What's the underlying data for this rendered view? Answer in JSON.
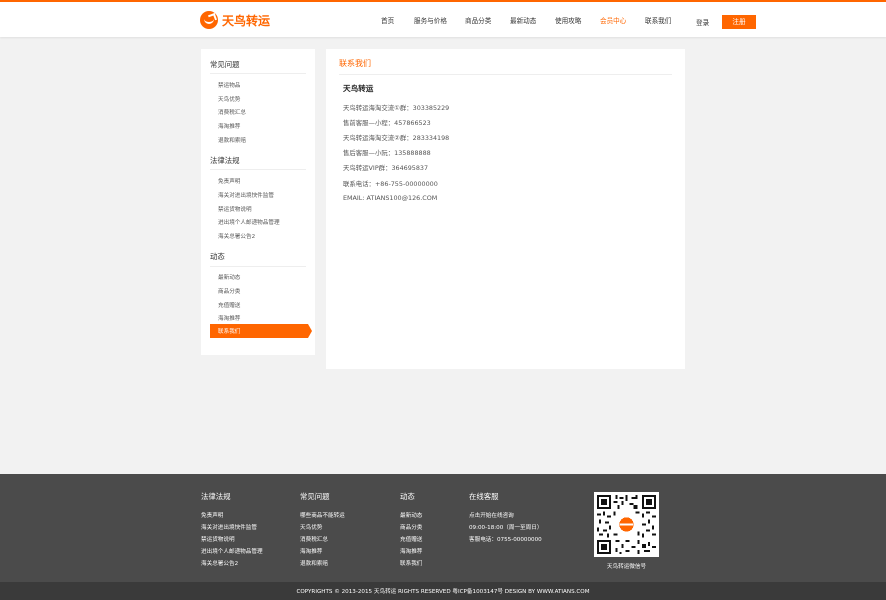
{
  "header": {
    "logo_text": "天鸟转运",
    "nav": [
      "首页",
      "服务与价格",
      "商品分类",
      "最新动态",
      "使用攻略",
      "会员中心",
      "联系我们"
    ],
    "active_nav": "会员中心",
    "login": "登录",
    "register": "注册",
    "accent_color": "#ff6600"
  },
  "sidebar": {
    "groups": [
      {
        "title": "常见问题",
        "items": [
          "禁运物品",
          "天鸟优势",
          "消费税汇总",
          "海淘推荐",
          "退款和索赔"
        ]
      },
      {
        "title": "法律法规",
        "items": [
          "免责声明",
          "海关对进出境快件监管",
          "禁运货物说明",
          "进出境个人邮递物品管理",
          "海关总署公告2"
        ]
      },
      {
        "title": "动态",
        "items": [
          "最新动态",
          "商品分类",
          "充值赠送",
          "海淘推荐",
          "联系我们"
        ]
      }
    ],
    "active_item": "联系我们"
  },
  "main": {
    "title": "联系我们",
    "company": "天鸟转运",
    "lines": [
      "天鸟转运海淘交流①群：303385229",
      "售前客服—小程：457866523",
      "天鸟转运海淘交流②群：283334198",
      "售后客服—小阮：135888888",
      "天鸟转运VIP群：364695837",
      "联系电话：+86-755-00000000",
      "EMAIL: ATIANS100@126.COM"
    ]
  },
  "footer": {
    "columns": [
      {
        "title": "法律法规",
        "items": [
          "免责声明",
          "海关对进出境快件监管",
          "禁运货物说明",
          "进出境个人邮递物品管理",
          "海关总署公告2"
        ]
      },
      {
        "title": "常见问题",
        "items": [
          "哪些商品不能转运",
          "天鸟优势",
          "消费税汇总",
          "海淘推荐",
          "退款和索赔"
        ]
      },
      {
        "title": "动态",
        "items": [
          "最新动态",
          "商品分类",
          "充值赠送",
          "海淘推荐",
          "联系我们"
        ]
      },
      {
        "title": "在线客服",
        "items": [
          "点击开始在线咨询",
          "09:00-18:00（周一至周日）",
          "客服电话：0755-00000000"
        ]
      }
    ],
    "qr_caption": "天鸟转运微信号",
    "copyright": "COPYRIGHTS © 2013-2015 天鸟转运 RIGHTS RESERVED      粤ICP备1003147号      DESIGN BY WWW.ATIANS.COM"
  }
}
